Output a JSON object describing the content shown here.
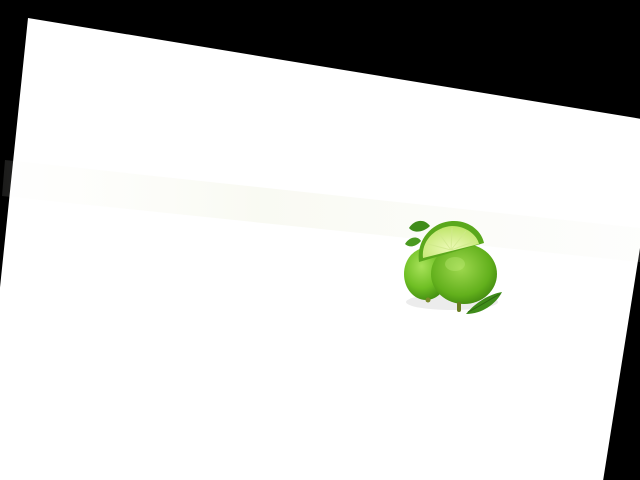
{
  "scene": {
    "subject": "limes-with-leaves",
    "background_color": "#000000",
    "paper_color": "#ffffff",
    "streak_color": "#f6f7f0",
    "lime_dark": "#4f9a14",
    "lime_mid": "#6fbf24",
    "lime_light": "#a8e25a",
    "lime_flesh": "#d9f28a",
    "leaf_color": "#3f8c1a",
    "shadow_color": "#d8d8d8"
  }
}
